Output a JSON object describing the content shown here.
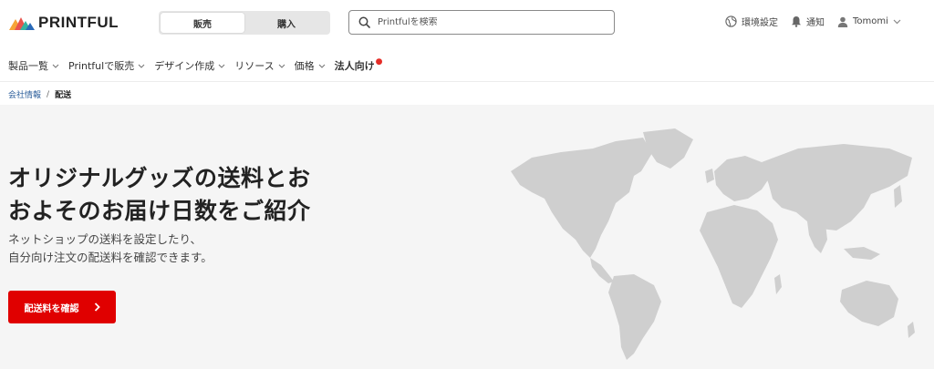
{
  "brand": {
    "name": "PRINTFUL",
    "logo_colors": [
      "#f6a437",
      "#e9534d",
      "#35b3a1",
      "#2a6ab8"
    ]
  },
  "mode_toggle": {
    "options": [
      {
        "label": "販売",
        "active": true
      },
      {
        "label": "購入",
        "active": false
      }
    ]
  },
  "search": {
    "placeholder": "Printfulを検索",
    "icon": "search-icon"
  },
  "utilities": {
    "settings_label": "環境設定",
    "notifications_label": "通知",
    "user_name": "Tomomi"
  },
  "nav": {
    "items": [
      {
        "label": "製品一覧"
      },
      {
        "label": "Printfulで販売"
      },
      {
        "label": "デザイン作成"
      },
      {
        "label": "リソース"
      },
      {
        "label": "価格"
      },
      {
        "label": "法人向け"
      }
    ]
  },
  "breadcrumb": {
    "parent": "会社情報",
    "separator": "/",
    "current": "配送"
  },
  "hero": {
    "title_line1": "オリジナルグッズの送料とお",
    "title_line2": "およそのお届け日数をご紹介",
    "subtitle_line1": "ネットショップの送料を設定したり、",
    "subtitle_line2": "自分向け注文の配送料を確認できます。",
    "cta_label": "配送料を確認",
    "accent_color": "#e00000",
    "map_color": "#cfcfcf"
  }
}
